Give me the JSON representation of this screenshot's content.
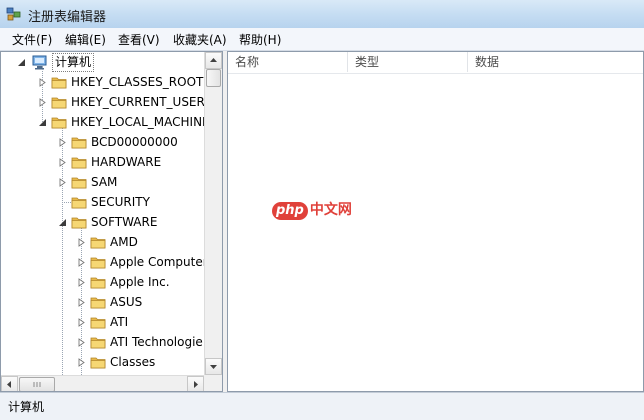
{
  "window": {
    "title": "注册表编辑器",
    "icon": "registry-editor-icon"
  },
  "menu": [
    "文件(F)",
    "编辑(E)",
    "查看(V)",
    "收藏夹(A)",
    "帮助(H)"
  ],
  "tree": {
    "root": "计算机",
    "nodes": [
      {
        "label": "HKEY_CLASSES_ROOT",
        "level": 1,
        "expanded": false
      },
      {
        "label": "HKEY_CURRENT_USER",
        "level": 1,
        "expanded": false
      },
      {
        "label": "HKEY_LOCAL_MACHINE",
        "level": 1,
        "expanded": true
      },
      {
        "label": "BCD00000000",
        "level": 2,
        "expanded": false
      },
      {
        "label": "HARDWARE",
        "level": 2,
        "expanded": false
      },
      {
        "label": "SAM",
        "level": 2,
        "expanded": false
      },
      {
        "label": "SECURITY",
        "level": 2,
        "expanded": null
      },
      {
        "label": "SOFTWARE",
        "level": 2,
        "expanded": true
      },
      {
        "label": "AMD",
        "level": 3,
        "expanded": false
      },
      {
        "label": "Apple Computer",
        "level": 3,
        "expanded": false
      },
      {
        "label": "Apple Inc.",
        "level": 3,
        "expanded": false
      },
      {
        "label": "ASUS",
        "level": 3,
        "expanded": false
      },
      {
        "label": "ATI",
        "level": 3,
        "expanded": false
      },
      {
        "label": "ATI Technologie",
        "level": 3,
        "expanded": false
      },
      {
        "label": "Classes",
        "level": 3,
        "expanded": false
      }
    ]
  },
  "list": {
    "columns": [
      "名称",
      "类型",
      "数据"
    ]
  },
  "watermark": {
    "brand": "php",
    "suffix": "中文网"
  },
  "status": {
    "path": "计算机"
  }
}
